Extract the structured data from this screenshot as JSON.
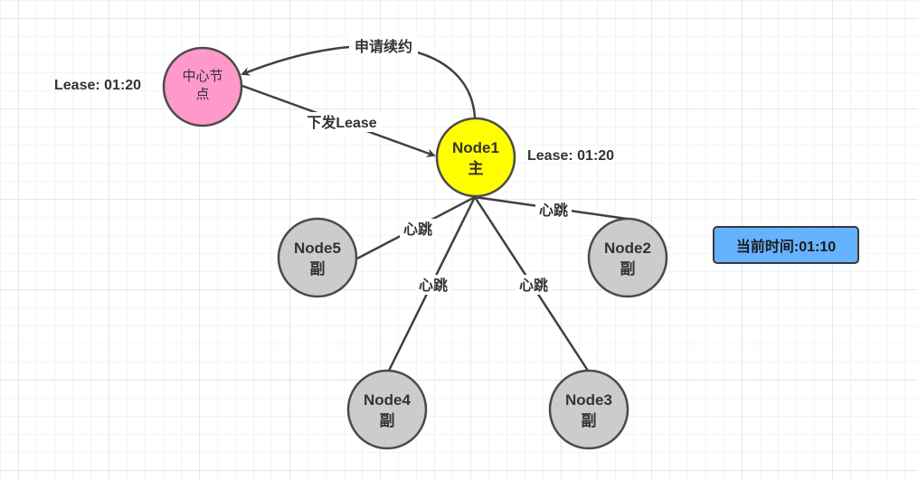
{
  "center_node": {
    "line1": "中心节",
    "line2": "点",
    "color": "#ff99cc",
    "lease_label": "Lease: 01:20"
  },
  "master_node": {
    "name": "Node1",
    "role": "主",
    "color": "#ffff00",
    "lease_label": "Lease: 01:20"
  },
  "replica_nodes": [
    {
      "name": "Node5",
      "role": "副"
    },
    {
      "name": "Node2",
      "role": "副"
    },
    {
      "name": "Node4",
      "role": "副"
    },
    {
      "name": "Node3",
      "role": "副"
    }
  ],
  "replica_color": "#cccccc",
  "edges": {
    "renew_request": "申请续约",
    "issue_lease": "下发Lease",
    "heartbeat": "心跳"
  },
  "current_time": {
    "label": "当前时间:01:10",
    "color": "#66b2ff"
  }
}
